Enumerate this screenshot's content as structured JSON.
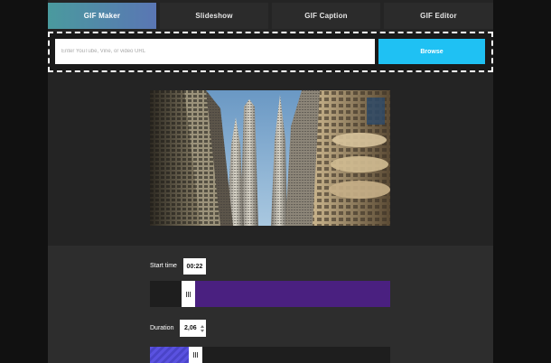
{
  "tabs": [
    {
      "label": "GIF Maker",
      "active": true
    },
    {
      "label": "Slideshow",
      "active": false
    },
    {
      "label": "GIF Caption",
      "active": false
    },
    {
      "label": "GIF Editor",
      "active": false
    }
  ],
  "url_bar": {
    "placeholder": "Enter YouTube, Vine, or video URL",
    "value": "",
    "browse_label": "Browse"
  },
  "preview": {
    "icon": "video-frame-skyscrapers"
  },
  "controls": {
    "start_time": {
      "label": "Start time",
      "value": "00:22",
      "color": "#4a2080"
    },
    "duration": {
      "label": "Duration",
      "value": "2,06",
      "color": "#5a52e0"
    }
  },
  "colors": {
    "accent_tab_start": "#4a9a9e",
    "accent_tab_end": "#5a76b4",
    "browse": "#1fc1f3"
  }
}
